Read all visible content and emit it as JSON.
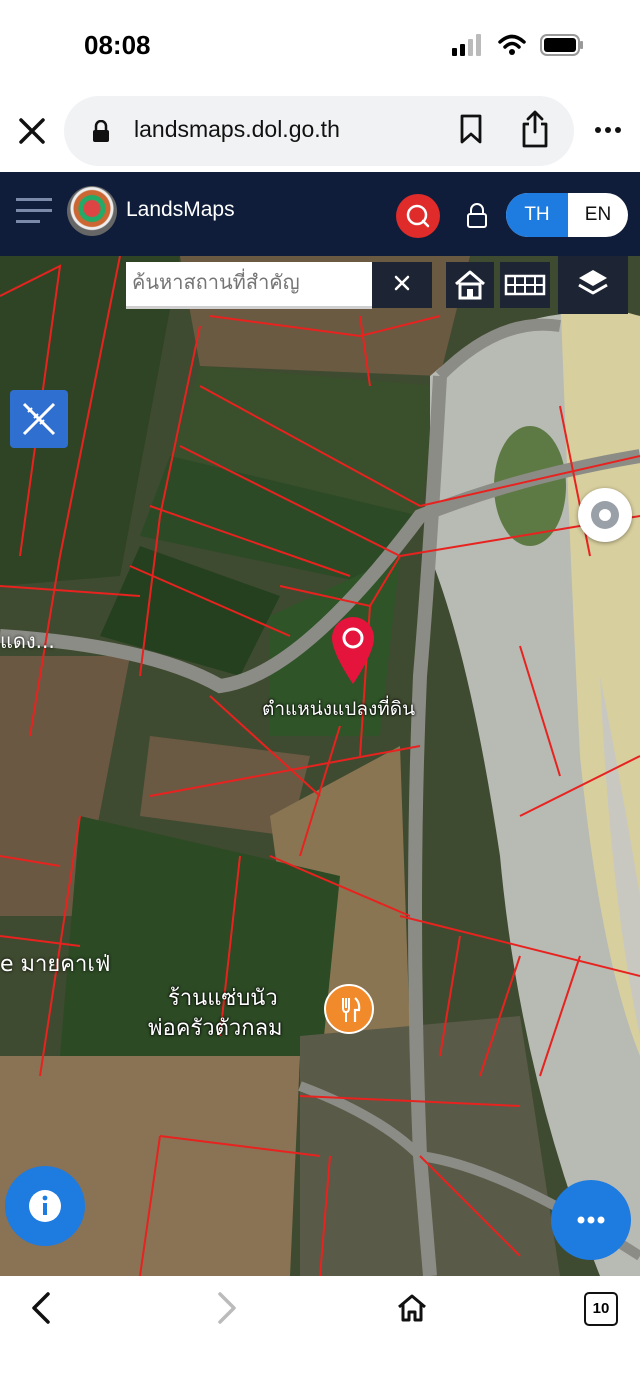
{
  "status_bar": {
    "time": "08:08"
  },
  "browser": {
    "url": "landsmaps.dol.go.th",
    "tabs_count": "10"
  },
  "app": {
    "brand": "LandsMaps",
    "lang_th": "TH",
    "lang_en": "EN"
  },
  "map": {
    "search_placeholder": "ค้นหาสถานที่สำคัญ",
    "parcel_label": "ตำแหน่งแปลงที่ดิน",
    "road_label": "แดง...",
    "cafe_label": "e มายคาเฟ่",
    "poi_name_line1": "ร้านแซ่บนัว",
    "poi_name_line2": "พ่อครัวตัวกลม"
  },
  "colors": {
    "navbar": "#0f1d3a",
    "accent": "#1e7be0",
    "search_button": "#e02b2b",
    "parcel_lines": "#e8221f",
    "poi": "#f08a2a"
  },
  "icons": [
    "close-icon",
    "lock-icon",
    "bookmark-icon",
    "share-icon",
    "more-icon",
    "menu-icon",
    "search-icon",
    "lock-icon",
    "home-icon",
    "grid-icon",
    "layers-icon",
    "ruler-pencil-icon",
    "map-pin-icon",
    "restaurant-icon",
    "compass-icon",
    "info-icon",
    "more-icon",
    "back-icon",
    "forward-icon",
    "home-icon",
    "tabs-icon"
  ]
}
